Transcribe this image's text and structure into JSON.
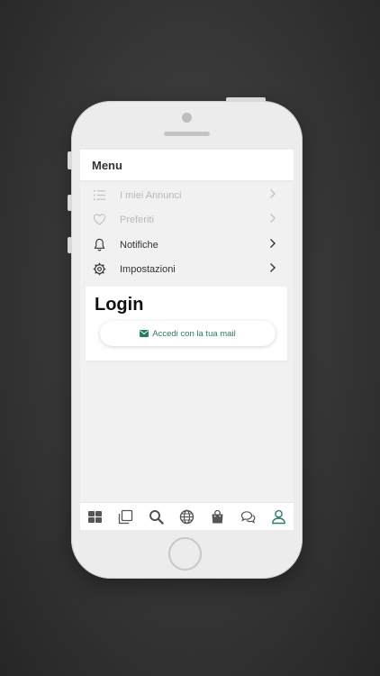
{
  "menu": {
    "title": "Menu"
  },
  "items": [
    {
      "label": "I miei Annunci",
      "icon": "list-icon",
      "enabled": false
    },
    {
      "label": "Preferiti",
      "icon": "heart-icon",
      "enabled": false
    },
    {
      "label": "Notifiche",
      "icon": "bell-icon",
      "enabled": true
    },
    {
      "label": "Impostazioni",
      "icon": "gear-icon",
      "enabled": true
    }
  ],
  "login": {
    "title": "Login",
    "email_button_label": "Accedi con la tua mail",
    "email_button_icon": "envelope-icon"
  },
  "tabbar": {
    "tabs": [
      "grid-icon",
      "pages-icon",
      "search-icon",
      "globe-icon",
      "bag-icon",
      "chat-icon",
      "user-icon"
    ],
    "active": "user-icon"
  },
  "colors": {
    "accent": "#2c7a6a",
    "disabled_text": "#b8b8b8",
    "text": "#333333"
  }
}
